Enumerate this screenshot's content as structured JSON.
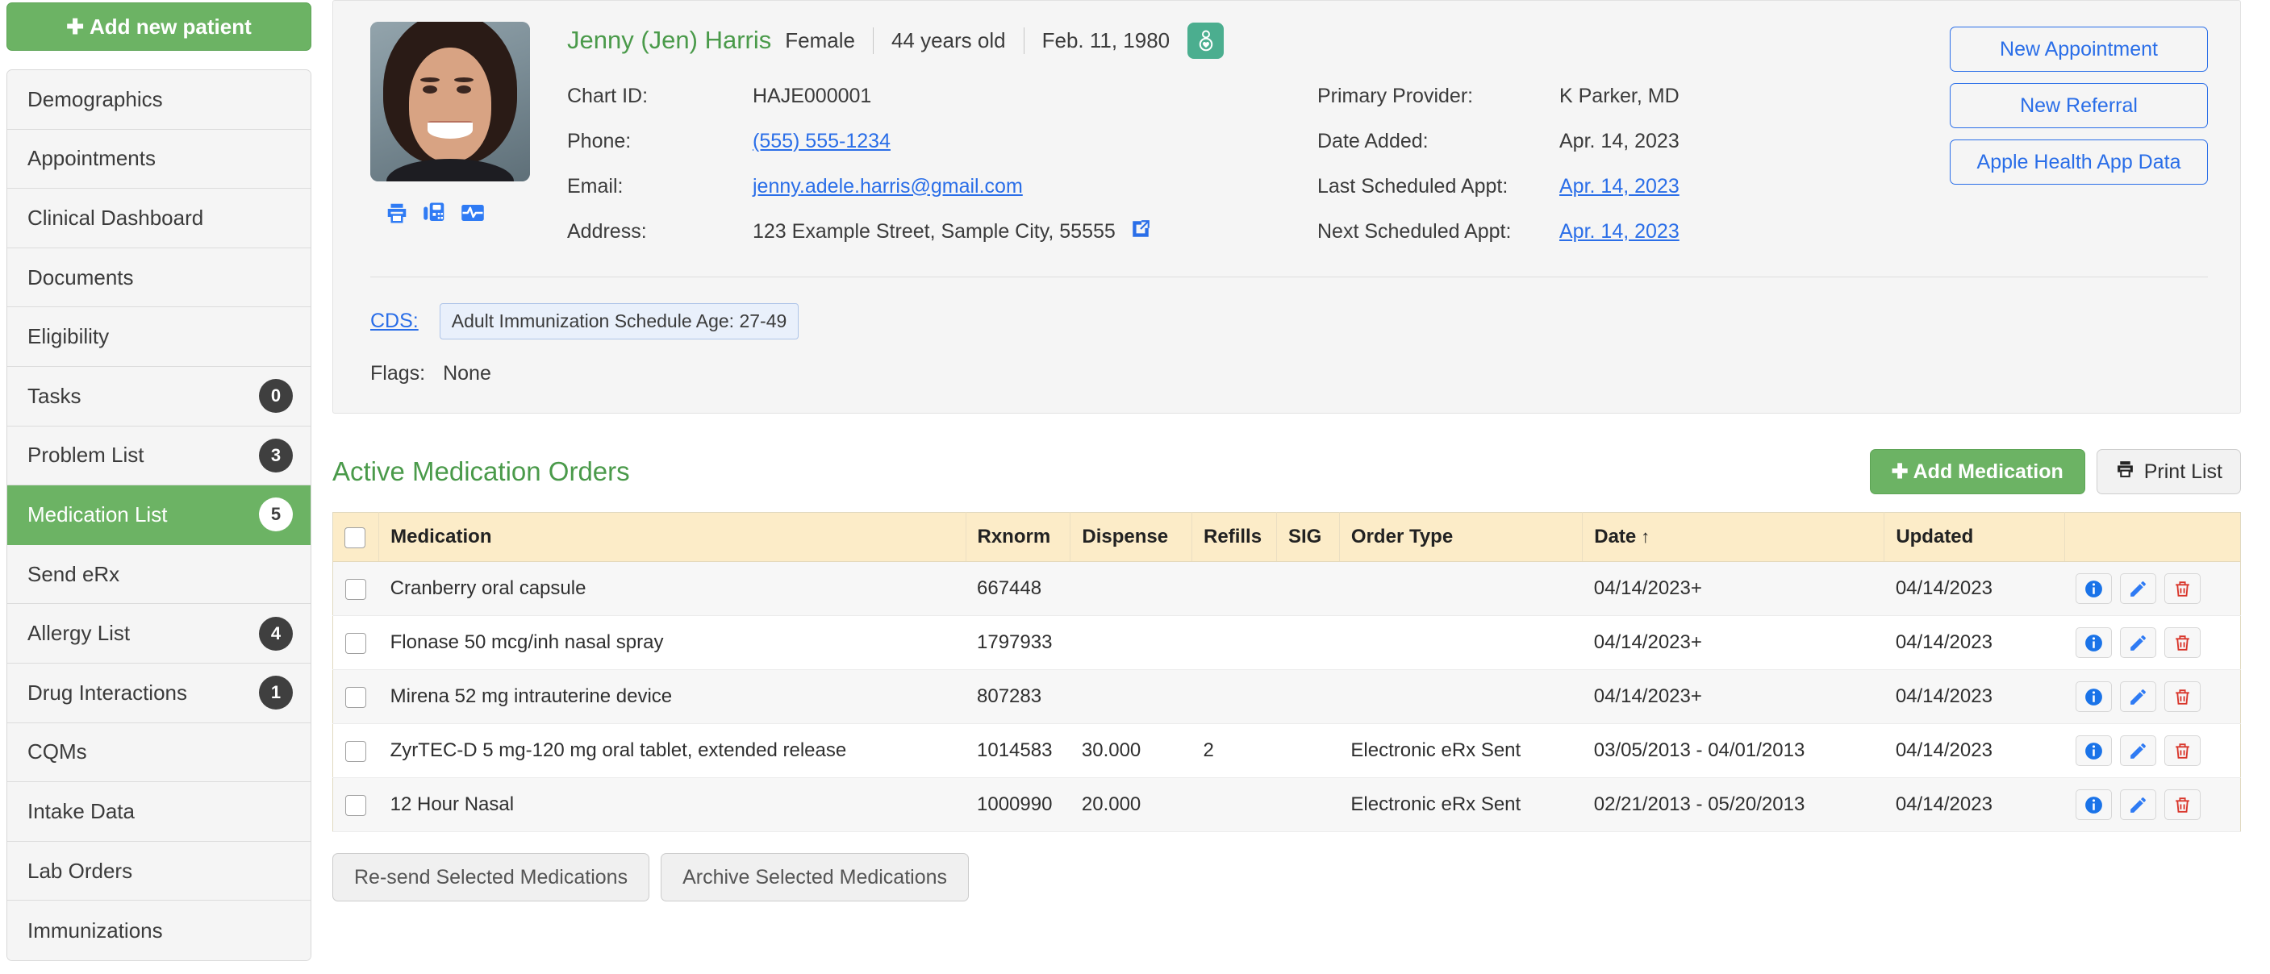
{
  "sidebar": {
    "add_patient_label": "Add new patient",
    "items": [
      {
        "label": "Demographics",
        "badge": null,
        "active": false
      },
      {
        "label": "Appointments",
        "badge": null,
        "active": false
      },
      {
        "label": "Clinical Dashboard",
        "badge": null,
        "active": false
      },
      {
        "label": "Documents",
        "badge": null,
        "active": false
      },
      {
        "label": "Eligibility",
        "badge": null,
        "active": false
      },
      {
        "label": "Tasks",
        "badge": "0",
        "active": false
      },
      {
        "label": "Problem List",
        "badge": "3",
        "active": false
      },
      {
        "label": "Medication List",
        "badge": "5",
        "active": true
      },
      {
        "label": "Send eRx",
        "badge": null,
        "active": false
      },
      {
        "label": "Allergy List",
        "badge": "4",
        "active": false
      },
      {
        "label": "Drug Interactions",
        "badge": "1",
        "active": false
      },
      {
        "label": "CQMs",
        "badge": null,
        "active": false
      },
      {
        "label": "Intake Data",
        "badge": null,
        "active": false
      },
      {
        "label": "Lab Orders",
        "badge": null,
        "active": false
      },
      {
        "label": "Immunizations",
        "badge": null,
        "active": false
      }
    ]
  },
  "patient": {
    "name": "Jenny (Jen) Harris",
    "gender": "Female",
    "age": "44 years old",
    "dob": "Feb. 11, 1980",
    "gender_badge_icon": "person-heart-icon",
    "photo_alt": "patient-photo",
    "quick_icons": [
      "print-icon",
      "fax-icon",
      "vitals-chart-icon"
    ],
    "left_fields": [
      {
        "label": "Chart ID:",
        "value": "HAJE000001",
        "link": false
      },
      {
        "label": "Phone:",
        "value": "(555) 555-1234",
        "link": true
      },
      {
        "label": "Email:",
        "value": "jenny.adele.harris@gmail.com",
        "link": true
      },
      {
        "label": "Address:",
        "value": "123 Example Street, Sample City, 55555",
        "link": false,
        "external_icon": "external-link-icon"
      }
    ],
    "right_fields": [
      {
        "label": "Primary Provider:",
        "value": "K Parker, MD",
        "link": false
      },
      {
        "label": "Date Added:",
        "value": "Apr. 14, 2023",
        "link": false
      },
      {
        "label": "Last Scheduled Appt:",
        "value": "Apr. 14, 2023",
        "link": true
      },
      {
        "label": "Next Scheduled Appt:",
        "value": "Apr. 14, 2023",
        "link": true
      }
    ],
    "header_buttons": [
      "New Appointment",
      "New Referral",
      "Apple Health App Data"
    ],
    "cds_label": "CDS:",
    "cds_chip": "Adult Immunization Schedule Age: 27-49",
    "flags_label": "Flags:",
    "flags_value": "None"
  },
  "medications": {
    "title": "Active Medication Orders",
    "add_button": "Add Medication",
    "print_button": "Print List",
    "columns": [
      "Medication",
      "Rxnorm",
      "Dispense",
      "Refills",
      "SIG",
      "Order Type",
      "Date",
      "Updated"
    ],
    "sorted_column": "Date",
    "sort_direction": "↑",
    "rows": [
      {
        "medication": "Cranberry oral capsule",
        "rxnorm": "667448",
        "dispense": "",
        "refills": "",
        "sig": "",
        "order_type": "",
        "date": "04/14/2023+",
        "updated": "04/14/2023"
      },
      {
        "medication": "Flonase 50 mcg/inh nasal spray",
        "rxnorm": "1797933",
        "dispense": "",
        "refills": "",
        "sig": "",
        "order_type": "",
        "date": "04/14/2023+",
        "updated": "04/14/2023"
      },
      {
        "medication": "Mirena 52 mg intrauterine device",
        "rxnorm": "807283",
        "dispense": "",
        "refills": "",
        "sig": "",
        "order_type": "",
        "date": "04/14/2023+",
        "updated": "04/14/2023"
      },
      {
        "medication": "ZyrTEC-D 5 mg-120 mg oral tablet, extended release",
        "rxnorm": "1014583",
        "dispense": "30.000",
        "refills": "2",
        "sig": "",
        "order_type": "Electronic eRx Sent",
        "date": "03/05/2013 - 04/01/2013",
        "updated": "04/14/2023"
      },
      {
        "medication": "12 Hour Nasal",
        "rxnorm": "1000990",
        "dispense": "20.000",
        "refills": "",
        "sig": "",
        "order_type": "Electronic eRx Sent",
        "date": "02/21/2013 - 05/20/2013",
        "updated": "04/14/2023"
      }
    ],
    "row_action_icons": [
      "info-icon",
      "edit-icon",
      "delete-icon"
    ],
    "footer_buttons": [
      "Re-send Selected Medications",
      "Archive Selected Medications"
    ]
  },
  "colors": {
    "brand_green": "#6cb364",
    "title_green": "#4a9a4a",
    "link_blue": "#2a6ee8",
    "table_header": "#fcecc8",
    "delete_red": "#d9362b",
    "badge_dark": "#3f3f3f"
  }
}
